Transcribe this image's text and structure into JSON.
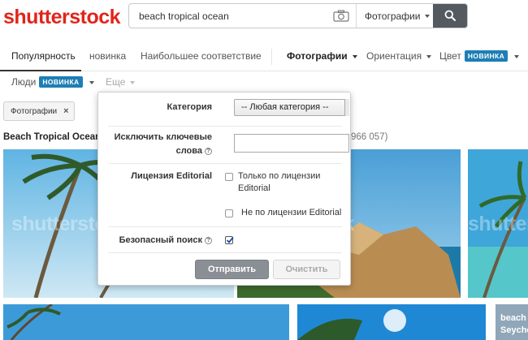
{
  "header": {
    "logo": "shutterstock",
    "search_value": "beach tropical ocean",
    "search_type": "Фотографии"
  },
  "sortbar": {
    "popular": "Популярность",
    "new": "новинка",
    "relevant": "Наибольшее соответствие",
    "photos": "Фотографии",
    "orientation": "Ориентация",
    "color": "Цвет",
    "badge_new": "НОВИНКА"
  },
  "row2": {
    "people": "Люди",
    "badge_new": "НОВИНКА",
    "more": "Еще"
  },
  "filter_chip": "Фотографии",
  "results": {
    "title": "Beach Tropical Ocean",
    "count": "966 057)"
  },
  "panel": {
    "category_label": "Категория",
    "category_value": "-- Любая категория --",
    "exclude_label_1": "Исключить ключевые",
    "exclude_label_2": "слова",
    "exclude_value": "",
    "editorial_label": "Лицензия Editorial",
    "editorial_only_1": "Только по лицензии",
    "editorial_only_2": "Editorial",
    "editorial_not": "Не по лицензии Editorial",
    "safe_label": "Безопасный поиск",
    "submit": "Отправить",
    "clear": "Очистить",
    "editorial_only_checked": false,
    "editorial_not_checked": false,
    "safe_checked": true
  },
  "images": {
    "watermark": "shutterstock",
    "label_1": "beach",
    "label_2": "Seyche"
  },
  "colors": {
    "brand": "#e1251b",
    "badge": "#1e7eb5",
    "search_button": "#555a60"
  }
}
